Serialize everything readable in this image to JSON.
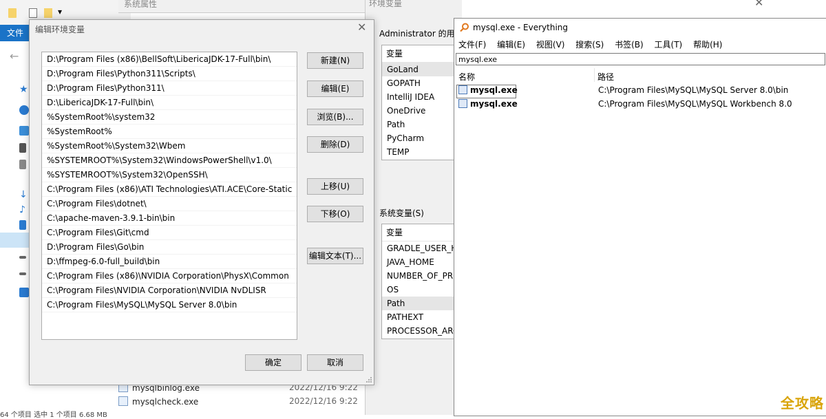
{
  "explorer": {
    "ribbon_tab": "文件",
    "files": [
      {
        "name": "mysqlbinlog.exe",
        "date": "2022/12/16 9:22"
      },
      {
        "name": "mysqlcheck.exe",
        "date": "2022/12/16 9:22"
      }
    ],
    "status": "64 个项目   选中 1 个项目  6.68 MB"
  },
  "system_properties": {
    "title": "系统属性"
  },
  "env_dialog": {
    "title": "环境变量",
    "user_section": "Administrator 的用户",
    "system_section": "系统变量(S)",
    "column_header": "变量",
    "user_vars": [
      "GoLand",
      "GOPATH",
      "IntelliJ IDEA",
      "OneDrive",
      "Path",
      "PyCharm",
      "TEMP"
    ],
    "system_vars": [
      "GRADLE_USER_HO",
      "JAVA_HOME",
      "NUMBER_OF_PRO",
      "OS",
      "Path",
      "PATHEXT",
      "PROCESSOR_ARCI"
    ]
  },
  "edit_dialog": {
    "title": "编辑环境变量",
    "paths": [
      "D:\\Program Files (x86)\\BellSoft\\LibericaJDK-17-Full\\bin\\",
      "D:\\Program Files\\Python311\\Scripts\\",
      "D:\\Program Files\\Python311\\",
      "D:\\LibericaJDK-17-Full\\bin\\",
      "%SystemRoot%\\system32",
      "%SystemRoot%",
      "%SystemRoot%\\System32\\Wbem",
      "%SYSTEMROOT%\\System32\\WindowsPowerShell\\v1.0\\",
      "%SYSTEMROOT%\\System32\\OpenSSH\\",
      "C:\\Program Files (x86)\\ATI Technologies\\ATI.ACE\\Core-Static",
      "C:\\Program Files\\dotnet\\",
      "C:\\apache-maven-3.9.1-bin\\bin",
      "C:\\Program Files\\Git\\cmd",
      "D:\\Program Files\\Go\\bin",
      "D:\\ffmpeg-6.0-full_build\\bin",
      "C:\\Program Files (x86)\\NVIDIA Corporation\\PhysX\\Common",
      "C:\\Program Files\\NVIDIA Corporation\\NVIDIA NvDLISR",
      "C:\\Program Files\\MySQL\\MySQL Server 8.0\\bin"
    ],
    "buttons": {
      "new": "新建(N)",
      "edit": "编辑(E)",
      "browse": "浏览(B)...",
      "delete": "删除(D)",
      "move_up": "上移(U)",
      "move_down": "下移(O)",
      "edit_text": "编辑文本(T)...",
      "ok": "确定",
      "cancel": "取消"
    }
  },
  "everything": {
    "title": "mysql.exe - Everything",
    "menu": [
      "文件(F)",
      "编辑(E)",
      "视图(V)",
      "搜索(S)",
      "书签(B)",
      "工具(T)",
      "帮助(H)"
    ],
    "search_value": "mysql.exe",
    "columns": {
      "name": "名称",
      "path": "路径"
    },
    "results": [
      {
        "name": "mysql.exe",
        "path": "C:\\Program Files\\MySQL\\MySQL Server 8.0\\bin"
      },
      {
        "name": "mysql.exe",
        "path": "C:\\Program Files\\MySQL\\MySQL Workbench 8.0"
      }
    ]
  },
  "watermark": "全攻略",
  "colors": {
    "accent": "#1a73c7",
    "watermark": "#d9a40a"
  }
}
